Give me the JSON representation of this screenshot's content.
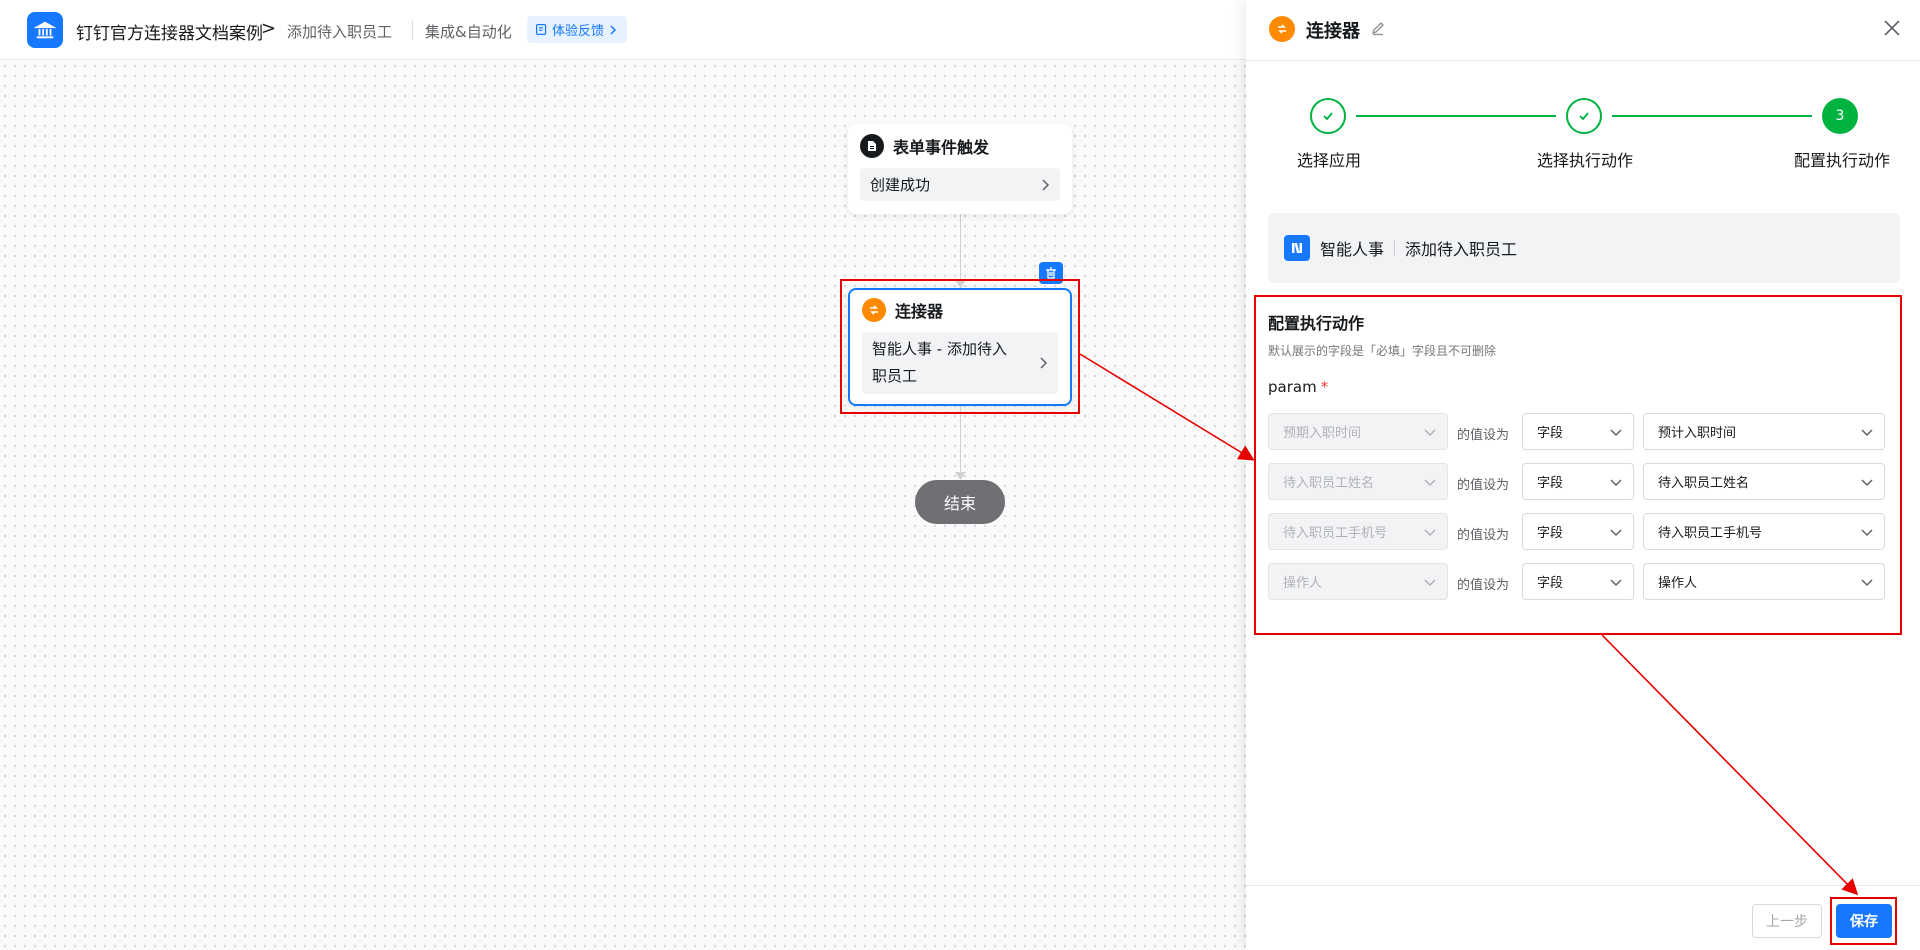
{
  "header": {
    "app_title": "钉钉官方连接器文档案例",
    "breadcrumb_separator": ">",
    "page_name": "添加待入职员工",
    "section": "集成&自动化",
    "feedback_label": "体验反馈"
  },
  "canvas": {
    "trigger_node": {
      "title": "表单事件触发",
      "body": "创建成功"
    },
    "connector_node": {
      "title": "连接器",
      "body": "智能人事 - 添加待入职员工"
    },
    "end_node": {
      "label": "结束"
    }
  },
  "drawer": {
    "title": "连接器",
    "steps": [
      {
        "label": "选择应用",
        "state": "done"
      },
      {
        "label": "选择执行动作",
        "state": "done"
      },
      {
        "label": "配置执行动作",
        "state": "active",
        "number": "3"
      }
    ],
    "app_bar": {
      "app_name": "智能人事",
      "action_name": "添加待入职员工"
    },
    "config": {
      "title": "配置执行动作",
      "description": "默认展示的字段是「必填」字段且不可删除",
      "param_label": "param",
      "required_mark": "*",
      "rows": [
        {
          "field": "预期入职时间",
          "connector_text": "的值设为",
          "type": "字段",
          "value": "预计入职时间"
        },
        {
          "field": "待入职员工姓名",
          "connector_text": "的值设为",
          "type": "字段",
          "value": "待入职员工姓名"
        },
        {
          "field": "待入职员工手机号",
          "connector_text": "的值设为",
          "type": "字段",
          "value": "待入职员工手机号"
        },
        {
          "field": "操作人",
          "connector_text": "的值设为",
          "type": "字段",
          "value": "操作人"
        }
      ]
    },
    "footer": {
      "prev_label": "上一步",
      "save_label": "保存"
    }
  },
  "colors": {
    "primary": "#1677ff",
    "success": "#00b341",
    "connector_orange": "#ff8a00",
    "annotation_red": "#e60000"
  }
}
